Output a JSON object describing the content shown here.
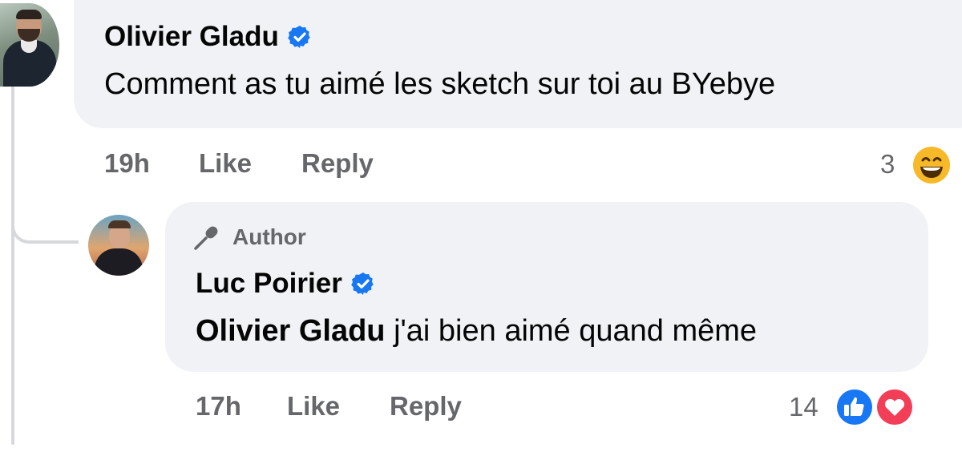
{
  "comment": {
    "author": "Olivier Gladu",
    "text": "Comment as tu aimé les sketch sur toi au BYebye",
    "time": "19h",
    "like_label": "Like",
    "reply_label": "Reply",
    "reaction_count": "3",
    "reaction_icons": [
      "laughing-emoji-icon"
    ]
  },
  "reply": {
    "badge": "Author",
    "author": "Luc Poirier",
    "mention": "Olivier Gladu",
    "text": " j'ai bien aimé quand même",
    "time": "17h",
    "like_label": "Like",
    "reply_label": "Reply",
    "reaction_count": "14",
    "reaction_icons": [
      "like-icon",
      "love-icon"
    ]
  },
  "colors": {
    "bubble": "#f0f2f5",
    "meta_text": "#65676b",
    "verified": "#1877f2",
    "like": "#1877f2",
    "love": "#f33e58"
  }
}
